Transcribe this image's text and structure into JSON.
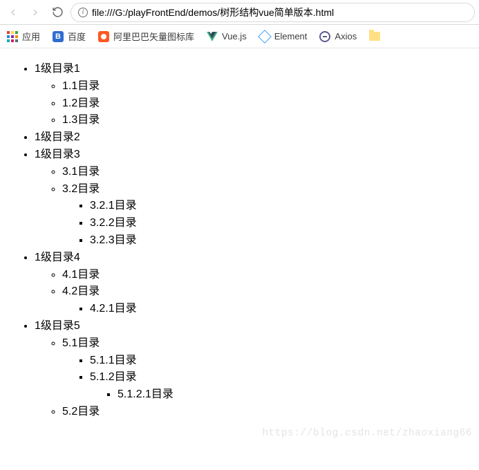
{
  "browser": {
    "url": "file:///G:/playFrontEnd/demos/树形结构vue简单版本.html"
  },
  "bookmarks": {
    "apps": "应用",
    "baidu": "百度",
    "iconfont": "阿里巴巴矢量图标库",
    "vue": "Vue.js",
    "element": "Element",
    "axios": "Axios"
  },
  "tree": [
    {
      "label": "1级目录1",
      "children": [
        {
          "label": "1.1目录"
        },
        {
          "label": "1.2目录"
        },
        {
          "label": "1.3目录"
        }
      ]
    },
    {
      "label": "1级目录2"
    },
    {
      "label": "1级目录3",
      "children": [
        {
          "label": "3.1目录"
        },
        {
          "label": "3.2目录",
          "children": [
            {
              "label": "3.2.1目录"
            },
            {
              "label": "3.2.2目录"
            },
            {
              "label": "3.2.3目录"
            }
          ]
        }
      ]
    },
    {
      "label": "1级目录4",
      "children": [
        {
          "label": "4.1目录"
        },
        {
          "label": "4.2目录",
          "children": [
            {
              "label": "4.2.1目录"
            }
          ]
        }
      ]
    },
    {
      "label": "1级目录5",
      "children": [
        {
          "label": "5.1目录",
          "children": [
            {
              "label": "5.1.1目录"
            },
            {
              "label": "5.1.2目录",
              "children": [
                {
                  "label": "5.1.2.1目录"
                }
              ]
            }
          ]
        },
        {
          "label": "5.2目录"
        }
      ]
    }
  ],
  "watermark": "https://blog.csdn.net/zhaoxiang66"
}
